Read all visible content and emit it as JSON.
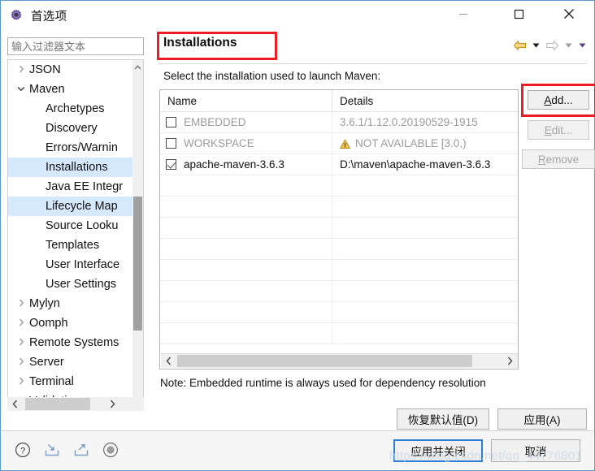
{
  "window": {
    "title": "首选项",
    "icon": "gear-icon",
    "minimize": "−",
    "maximize": "□",
    "close": "✕"
  },
  "sidebar": {
    "filter": {
      "placeholder": "输入过滤器文本",
      "value": ""
    },
    "items": [
      {
        "label": "JSON",
        "depth": 1,
        "twisty": "collapsed",
        "selected": false
      },
      {
        "label": "Maven",
        "depth": 1,
        "twisty": "expanded",
        "selected": false
      },
      {
        "label": "Archetypes",
        "depth": 2,
        "twisty": "none",
        "selected": false
      },
      {
        "label": "Discovery",
        "depth": 2,
        "twisty": "none",
        "selected": false
      },
      {
        "label": "Errors/Warnin",
        "depth": 2,
        "twisty": "none",
        "selected": false
      },
      {
        "label": "Installations",
        "depth": 2,
        "twisty": "none",
        "selected": true
      },
      {
        "label": "Java EE Integr",
        "depth": 2,
        "twisty": "none",
        "selected": false
      },
      {
        "label": "Lifecycle Map",
        "depth": 2,
        "twisty": "none",
        "selected": true
      },
      {
        "label": "Source Looku",
        "depth": 2,
        "twisty": "none",
        "selected": false
      },
      {
        "label": "Templates",
        "depth": 2,
        "twisty": "none",
        "selected": false
      },
      {
        "label": "User Interface",
        "depth": 2,
        "twisty": "none",
        "selected": false
      },
      {
        "label": "User Settings",
        "depth": 2,
        "twisty": "none",
        "selected": false
      },
      {
        "label": "Mylyn",
        "depth": 1,
        "twisty": "collapsed",
        "selected": false
      },
      {
        "label": "Oomph",
        "depth": 1,
        "twisty": "collapsed",
        "selected": false
      },
      {
        "label": "Remote Systems",
        "depth": 1,
        "twisty": "collapsed",
        "selected": false
      },
      {
        "label": "Server",
        "depth": 1,
        "twisty": "collapsed",
        "selected": false
      },
      {
        "label": "Terminal",
        "depth": 1,
        "twisty": "collapsed",
        "selected": false
      },
      {
        "label": "Validation",
        "depth": 1,
        "twisty": "none",
        "selected": false
      }
    ]
  },
  "page": {
    "title": "Installations",
    "description": "Select the installation used to launch Maven:",
    "note": "Note: Embedded runtime is always used for dependency resolution"
  },
  "nav": {
    "back": "back-arrow-icon",
    "back_menu": "▼",
    "forward": "forward-arrow-icon",
    "forward_menu": "▼",
    "view_menu": "▼"
  },
  "table": {
    "columns": [
      "Name",
      "Details"
    ],
    "rows": [
      {
        "checked": false,
        "name": "EMBEDDED",
        "details": "3.6.1/1.12.0.20190529-1915",
        "muted": true,
        "warn": false
      },
      {
        "checked": false,
        "name": "WORKSPACE",
        "details": "NOT AVAILABLE [3.0,)",
        "muted": true,
        "warn": true
      },
      {
        "checked": true,
        "name": "apache-maven-3.6.3",
        "details": "D:\\maven\\apache-maven-3.6.3",
        "muted": false,
        "warn": false
      }
    ],
    "empty_row_count": 8,
    "hscroll": {
      "left_arrow": "‹",
      "right_arrow": "›"
    }
  },
  "side_buttons": [
    {
      "label": "Add...",
      "mnemonic": "A",
      "enabled": true,
      "name": "add-button"
    },
    {
      "label": "Edit...",
      "mnemonic": "E",
      "enabled": false,
      "name": "edit-button"
    },
    {
      "label": "Remove",
      "mnemonic": "R",
      "enabled": false,
      "name": "remove-button"
    }
  ],
  "page_buttons": {
    "restore_defaults": "恢复默认值(D)",
    "apply": "应用(A)"
  },
  "footer": {
    "icons": [
      "help-icon",
      "import-icon",
      "export-icon",
      "record-icon"
    ],
    "apply_and_close": "应用并关闭",
    "cancel": "取消",
    "watermark": "https://blog.csdn.net/qq_44776801"
  },
  "colors": {
    "highlight": "#ec1c24",
    "selection": "#d6e8fb",
    "focus_border": "#2a7fd4",
    "warning": "#e8b33a",
    "back_arrow": "#d9a400"
  }
}
